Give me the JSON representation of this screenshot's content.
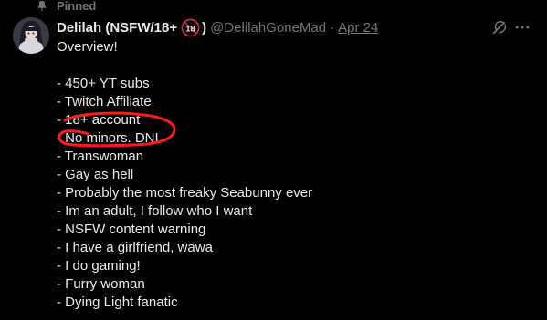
{
  "pinned": {
    "label": "Pinned",
    "icon": "pin-icon"
  },
  "author": {
    "display_name": "Delilah (NSFW/18+",
    "badge": "18",
    "close_paren": ")",
    "handle": "@DelilahGoneMad",
    "separator": "·",
    "date": "Apr 24",
    "avatar_icon": "avatar"
  },
  "actions": {
    "grok_icon": "grok-icon",
    "more_icon": "more-icon"
  },
  "post": {
    "lines": [
      "Overview!",
      "",
      "- 450+ YT subs",
      "- Twitch Affiliate",
      "- 18+ account",
      "- No minors. DNI",
      "- Transwoman",
      "- Gay as hell",
      "- Probably the most freaky Seabunny ever",
      "- Im an adult, I follow who I want",
      "- NSFW content warning",
      "- I have a girlfriend, wawa",
      "- I do gaming!",
      "- Furry woman",
      "- Dying Light fanatic"
    ]
  },
  "colors": {
    "background": "#000000",
    "text": "#e7e9ea",
    "muted": "#71767b",
    "badge_red": "#e0245e",
    "scribble_red": "#ff1a1a"
  }
}
